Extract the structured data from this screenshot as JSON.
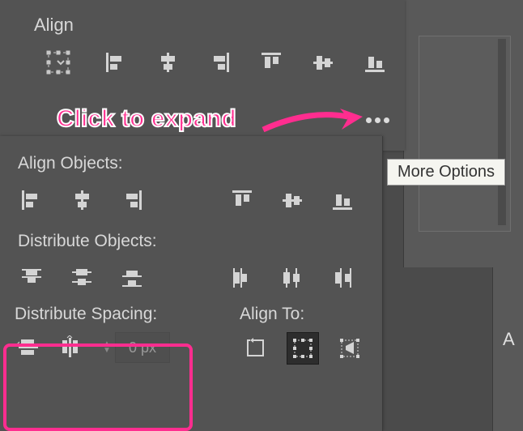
{
  "topPanel": {
    "title": "Align"
  },
  "mainPanel": {
    "alignObjects": "Align Objects:",
    "distributeObjects": "Distribute Objects:",
    "distributeSpacing": "Distribute Spacing:",
    "alignTo": "Align To:"
  },
  "spacingField": {
    "value": "0 px"
  },
  "tooltip": "More Options",
  "annotation": "Click to expand",
  "rightHint": "A",
  "colors": {
    "icon": "#d4d4d4",
    "accent": "#ff2d8f"
  }
}
